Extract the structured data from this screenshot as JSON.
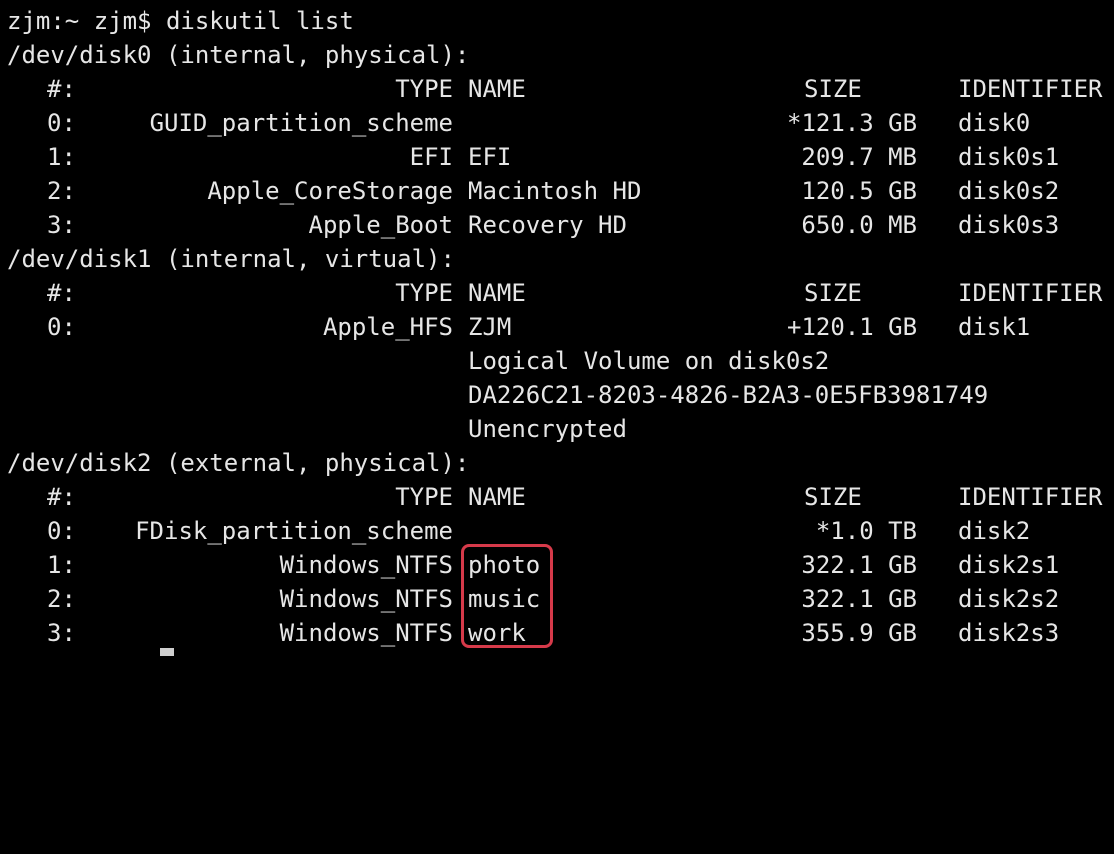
{
  "terminal": {
    "prompt": "zjm:~ zjm$ diskutil list",
    "top_fragment": "",
    "highlight_color": "#d63a4a"
  },
  "disks": [
    {
      "header": "/dev/disk0 (internal, physical):",
      "columns": {
        "num": "#:",
        "type": "TYPE",
        "name": "NAME",
        "size": "SIZE",
        "identifier": "IDENTIFIER"
      },
      "rows": [
        {
          "num": "0:",
          "type": "GUID_partition_scheme",
          "name": "",
          "size": "*121.3 GB",
          "identifier": "disk0"
        },
        {
          "num": "1:",
          "type": "EFI",
          "name": "EFI",
          "size": "209.7 MB",
          "identifier": "disk0s1"
        },
        {
          "num": "2:",
          "type": "Apple_CoreStorage",
          "name": "Macintosh HD",
          "size": "120.5 GB",
          "identifier": "disk0s2"
        },
        {
          "num": "3:",
          "type": "Apple_Boot",
          "name": "Recovery HD",
          "size": "650.0 MB",
          "identifier": "disk0s3"
        }
      ]
    },
    {
      "header": "/dev/disk1 (internal, virtual):",
      "columns": {
        "num": "#:",
        "type": "TYPE",
        "name": "NAME",
        "size": "SIZE",
        "identifier": "IDENTIFIER"
      },
      "rows": [
        {
          "num": "0:",
          "type": "Apple_HFS",
          "name": "ZJM",
          "size": "+120.1 GB",
          "identifier": "disk1"
        }
      ],
      "extra_lines": [
        "Logical Volume on disk0s2",
        "DA226C21-8203-4826-B2A3-0E5FB3981749",
        "Unencrypted"
      ]
    },
    {
      "header": "/dev/disk2 (external, physical):",
      "columns": {
        "num": "#:",
        "type": "TYPE",
        "name": "NAME",
        "size": "SIZE",
        "identifier": "IDENTIFIER"
      },
      "rows": [
        {
          "num": "0:",
          "type": "FDisk_partition_scheme",
          "name": "",
          "size": "*1.0 TB",
          "identifier": "disk2"
        },
        {
          "num": "1:",
          "type": "Windows_NTFS",
          "name": "photo",
          "size": "322.1 GB",
          "identifier": "disk2s1"
        },
        {
          "num": "2:",
          "type": "Windows_NTFS",
          "name": "music",
          "size": "322.1 GB",
          "identifier": "disk2s2"
        },
        {
          "num": "3:",
          "type": "Windows_NTFS",
          "name": "work",
          "size": "355.9 GB",
          "identifier": "disk2s3"
        }
      ]
    }
  ]
}
